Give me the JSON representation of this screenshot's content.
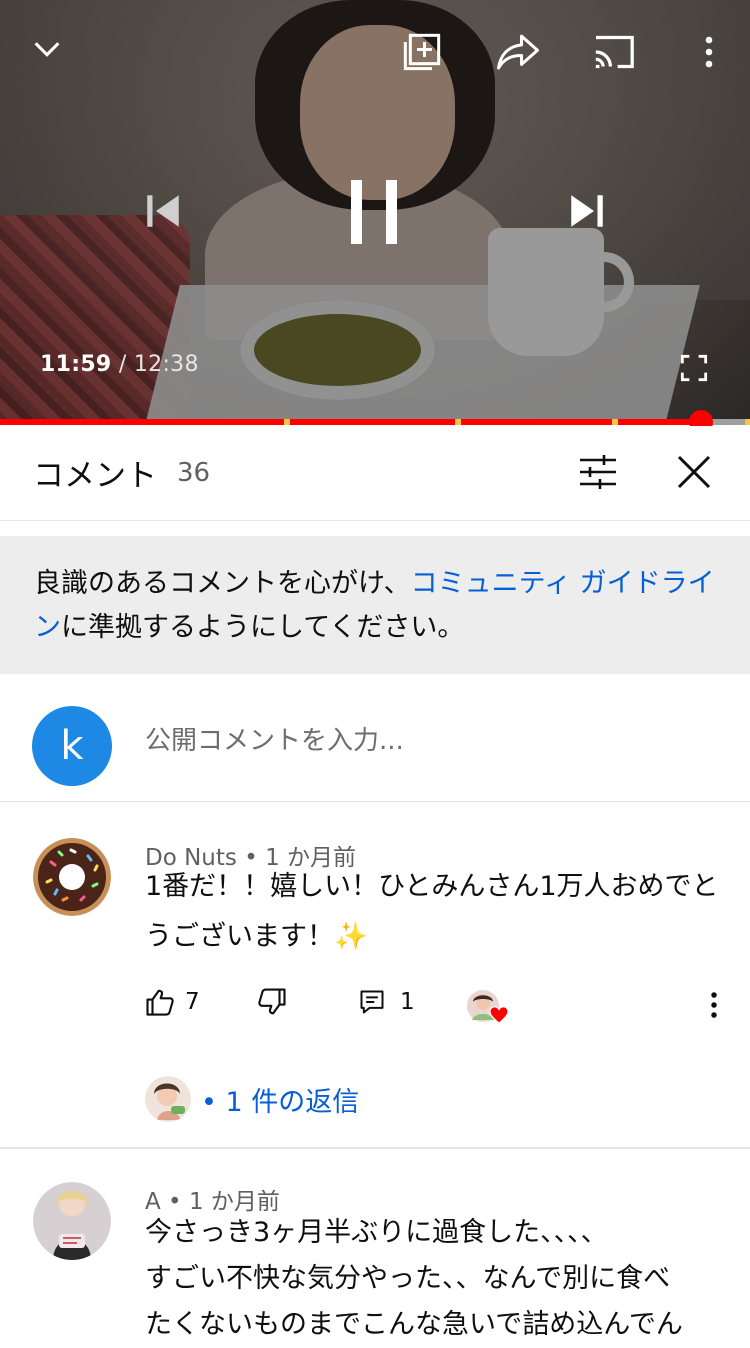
{
  "player": {
    "current_time": "11:59",
    "separator": "/",
    "duration": "12:38",
    "progress_fraction": 0.934,
    "chapter_marks": [
      0.378,
      0.606,
      0.816,
      0.993
    ]
  },
  "icons": {
    "collapse": "chevron-down-icon",
    "add_to_playlist": "playlist-add-icon",
    "share": "share-icon",
    "cast": "cast-icon",
    "more": "more-vert-icon",
    "previous": "skip-previous-icon",
    "pause": "pause-icon",
    "next": "skip-next-icon",
    "fullscreen": "fullscreen-icon",
    "sort": "sort-filter-icon",
    "close": "close-icon",
    "like": "thumb-up-icon",
    "dislike": "thumb-down-icon",
    "reply": "reply-icon",
    "heart": "heart-icon"
  },
  "comments_header": {
    "title": "コメント",
    "count": "36"
  },
  "notice": {
    "text_before": "良識のあるコメントを心がけ、",
    "link": "コミュニティ ガイドライン",
    "text_after": "に準拠するようにしてください。"
  },
  "add_comment": {
    "avatar_letter": "k",
    "placeholder": "公開コメントを入力..."
  },
  "comments": [
    {
      "author": "Do Nuts",
      "bullet": "•",
      "age": "1 か月前",
      "text": "1番だ！！嬉しい！ひとみんさん1万人おめでとうございます！✨",
      "likes": "7",
      "replies_count": "1",
      "reply_link": "• 1 件の返信"
    },
    {
      "author": "A",
      "bullet": "•",
      "age": "1 か月前",
      "text_lines": [
        "今さっき3ヶ月半ぶりに過食した、、、、",
        "すごい不快な気分やった、、なんで別に食べ",
        "たくないものまでこんな急いで詰め込んでん"
      ]
    }
  ],
  "colors": {
    "accent_red": "#ff0000",
    "link_blue": "#065fd4",
    "avatar_blue": "#1e88e5",
    "notice_bg": "#ededed"
  }
}
